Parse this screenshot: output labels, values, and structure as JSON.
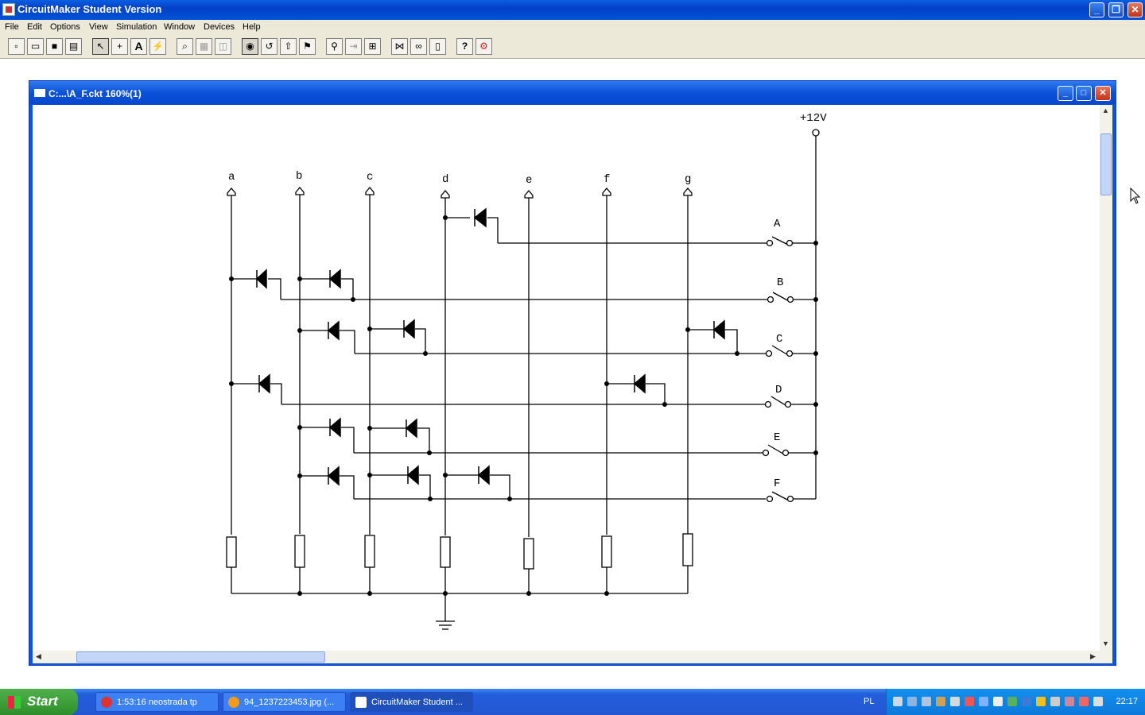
{
  "app": {
    "title": "CircuitMaker Student Version"
  },
  "menu": [
    "File",
    "Edit",
    "Options",
    "View",
    "Simulation",
    "Window",
    "Devices",
    "Help"
  ],
  "toolbar": {
    "buttons": [
      "new",
      "open",
      "save",
      "print",
      "arrow",
      "wire",
      "text",
      "probe",
      "zoom",
      "paste",
      "flip",
      "run-digital",
      "step",
      "trace",
      "run",
      "search",
      "bus",
      "device",
      "expand",
      "binoculars",
      "clipboard",
      "help",
      "options"
    ],
    "labels": {
      "text": "A",
      "help": "?"
    }
  },
  "document": {
    "title": "C:...\\A_F.ckt 160%(1)"
  },
  "schematic": {
    "supply_label": "+12V",
    "bus_labels": [
      "a",
      "b",
      "c",
      "d",
      "e",
      "f",
      "g"
    ],
    "switch_labels": [
      "A",
      "B",
      "C",
      "D",
      "E",
      "F"
    ]
  },
  "taskbar": {
    "start": "Start",
    "tasks": [
      {
        "label": "1:53:16 neostrada tp",
        "color": "#d33"
      },
      {
        "label": "94_1237223453.jpg (...",
        "color": "#f39a1c"
      },
      {
        "label": "CircuitMaker Student ...",
        "color": "#fff",
        "active": true
      }
    ],
    "lang": "PL",
    "clock": "22:17"
  }
}
